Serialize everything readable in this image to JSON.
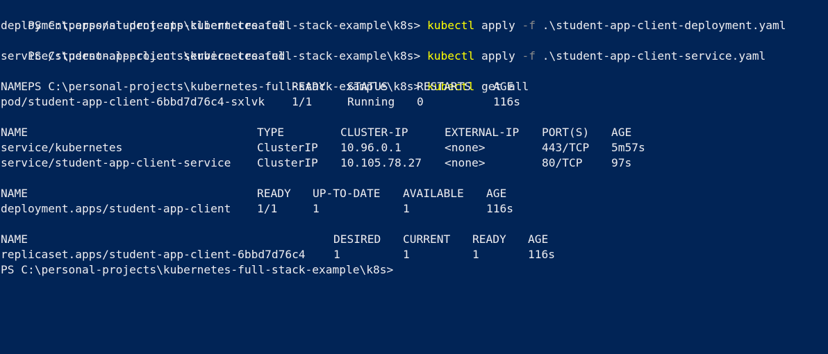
{
  "theme": {
    "background": "#012456",
    "text": "#eeedf0",
    "command": "#ffff00",
    "flag": "#8a8a8a"
  },
  "terminal": {
    "commands": [
      {
        "prompt": "PS C:\\personal-projects\\kubernetes-full-stack-example\\k8s> ",
        "command": "kubectl",
        "arg1": " apply ",
        "flag": "-f",
        "arg2": " .\\student-app-client-deployment.yaml"
      },
      {
        "prompt": "PS C:\\personal-projects\\kubernetes-full-stack-example\\k8s> ",
        "command": "kubectl",
        "arg1": " apply ",
        "flag": "-f",
        "arg2": " .\\student-app-client-service.yaml"
      },
      {
        "prompt": "PS C:\\personal-projects\\kubernetes-full-stack-example\\k8s> ",
        "command": "kubectl",
        "args": " get all"
      }
    ],
    "outputs": [
      "deployment.apps/student-app-client created",
      "service/student-app-client-service created"
    ],
    "pods": {
      "headers": [
        "NAME",
        "READY",
        "STATUS",
        "RESTARTS",
        "AGE"
      ],
      "rows": [
        [
          "pod/student-app-client-6bbd7d76c4-sxlvk",
          "1/1",
          "Running",
          "0",
          "116s"
        ]
      ]
    },
    "services": {
      "headers": [
        "NAME",
        "TYPE",
        "CLUSTER-IP",
        "EXTERNAL-IP",
        "PORT(S)",
        "AGE"
      ],
      "rows": [
        [
          "service/kubernetes",
          "ClusterIP",
          "10.96.0.1",
          "<none>",
          "443/TCP",
          "5m57s"
        ],
        [
          "service/student-app-client-service",
          "ClusterIP",
          "10.105.78.27",
          "<none>",
          "80/TCP",
          "97s"
        ]
      ]
    },
    "deployments": {
      "headers": [
        "NAME",
        "READY",
        "UP-TO-DATE",
        "AVAILABLE",
        "AGE"
      ],
      "rows": [
        [
          "deployment.apps/student-app-client",
          "1/1",
          "1",
          "1",
          "116s"
        ]
      ]
    },
    "replicasets": {
      "headers": [
        "NAME",
        "DESIRED",
        "CURRENT",
        "READY",
        "AGE"
      ],
      "rows": [
        [
          "replicaset.apps/student-app-client-6bbd7d76c4",
          "1",
          "1",
          "1",
          "116s"
        ]
      ]
    },
    "final_prompt": "PS C:\\personal-projects\\kubernetes-full-stack-example\\k8s>"
  }
}
